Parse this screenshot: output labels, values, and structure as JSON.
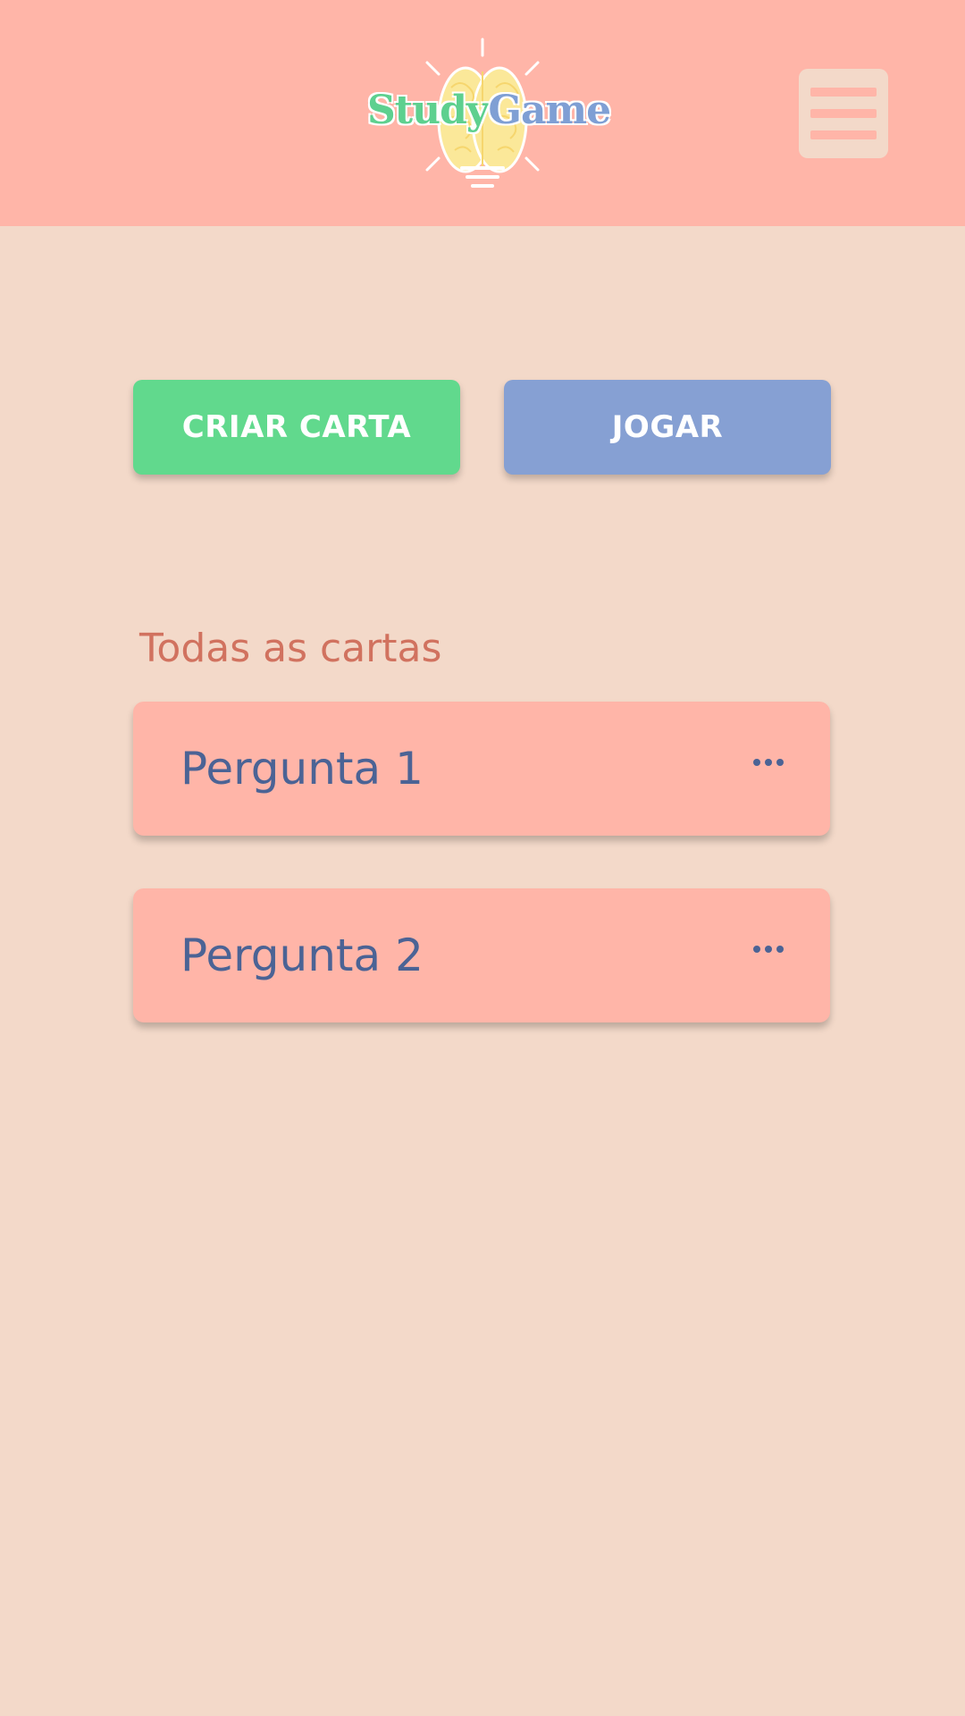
{
  "header": {
    "logo": {
      "word1": "Study",
      "word2": "Game",
      "word1_color": "#5ed08f",
      "word2_color": "#7f9fd4",
      "icon": "lightbulb-brain-icon"
    },
    "menu_icon": "hamburger-menu-icon",
    "background_color": "#ffb5a8"
  },
  "actions": {
    "create_label": "CRIAR CARTA",
    "create_color": "#61d98d",
    "play_label": "JOGAR",
    "play_color": "#86a0d3"
  },
  "cards_section": {
    "title": "Todas as cartas",
    "items": [
      {
        "label": "Pergunta 1",
        "more_icon": "more-horizontal-icon"
      },
      {
        "label": "Pergunta 2",
        "more_icon": "more-horizontal-icon"
      }
    ]
  },
  "colors": {
    "page_background": "#f3d9c9",
    "card_background": "#ffb5a8",
    "card_text": "#4b6395",
    "section_title": "#d1725f"
  }
}
